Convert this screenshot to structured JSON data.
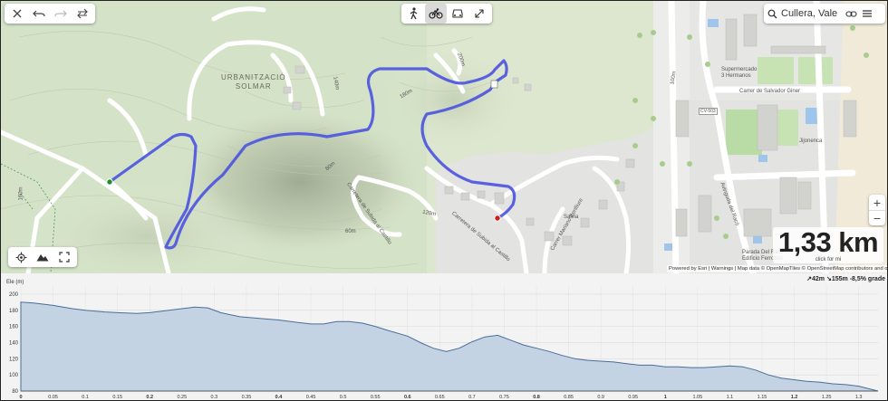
{
  "toolbar": {
    "close_icon": "close-icon",
    "undo_icon": "undo-icon",
    "redo_icon": "redo-icon",
    "reverse_icon": "reverse-route-icon"
  },
  "modes": [
    {
      "name": "walk",
      "icon": "walking-icon",
      "active": false
    },
    {
      "name": "bike",
      "icon": "bicycle-icon",
      "active": true
    },
    {
      "name": "car",
      "icon": "car-icon",
      "active": false
    },
    {
      "name": "straight",
      "icon": "straight-line-icon",
      "active": false
    }
  ],
  "search": {
    "value": "Cullera, Vale",
    "placeholder": ""
  },
  "map": {
    "labels": {
      "urbanitzacio": "URBANITZACIÓ",
      "solmar": "SOLMAR",
      "supermercado": "Supermercado",
      "hermanos": "3 Hermanos",
      "salvador_giner": "Carrer de Salvador Giner",
      "cv503": "CV-503",
      "jijonenca": "Jijonenca",
      "carretera": "Carretera de Subida al Castillo",
      "carretera2": "Carretera de Subida al Castillo",
      "salvia": "Salvia",
      "mariano": "Carrer Mariano Benlliure",
      "avinguda": "Avinguda del Racó",
      "parada": "Parada Del Racó",
      "edificio": "Edificio Ferrobós",
      "contours": [
        "160m",
        "140m",
        "120m",
        "100m",
        "80m",
        "60m",
        "200m",
        "180m"
      ]
    },
    "attribution": "Powered by Esri | Warnings | Map data © OpenMapTiles © OpenStreetMap contributors and others  Help",
    "route_color": "#4a52e0",
    "start_color": "#1f8c2e",
    "end_color": "#d21c1c"
  },
  "zoom": {
    "in": "+",
    "out": "−"
  },
  "bottom_controls": [
    "locate-icon",
    "terrain-icon",
    "fullscreen-icon"
  ],
  "distance": {
    "value": "1,33 km",
    "hint": "click for mi"
  },
  "stats": {
    "ascent": "↗42m",
    "descent": "↘155m",
    "grade": "-8,5% grade"
  },
  "chart_data": {
    "type": "area",
    "title": "",
    "ylabel": "Ele (m)",
    "xlabel": "",
    "ylim": [
      80,
      210
    ],
    "xlim": [
      0,
      1.33
    ],
    "yticks": [
      80,
      100,
      120,
      140,
      160,
      180,
      200
    ],
    "xticks": [
      "0",
      "0.05",
      "0.1",
      "0.15",
      "0.2",
      "0.25",
      "0.3",
      "0.35",
      "0.4",
      "0.45",
      "0.5",
      "0.55",
      "0.6",
      "0.65",
      "0.7",
      "0.75",
      "0.8",
      "0.85",
      "0.9",
      "0.95",
      "1",
      "1.05",
      "1.1",
      "1.15",
      "1.2",
      "1.25",
      "1.3"
    ],
    "x": [
      0,
      0.02,
      0.05,
      0.08,
      0.1,
      0.13,
      0.15,
      0.18,
      0.2,
      0.23,
      0.25,
      0.27,
      0.29,
      0.31,
      0.34,
      0.37,
      0.4,
      0.43,
      0.45,
      0.47,
      0.49,
      0.51,
      0.53,
      0.55,
      0.57,
      0.6,
      0.62,
      0.64,
      0.66,
      0.68,
      0.7,
      0.72,
      0.74,
      0.76,
      0.78,
      0.8,
      0.82,
      0.84,
      0.86,
      0.88,
      0.9,
      0.92,
      0.94,
      0.96,
      0.98,
      1.0,
      1.02,
      1.04,
      1.06,
      1.08,
      1.1,
      1.12,
      1.14,
      1.16,
      1.18,
      1.2,
      1.22,
      1.24,
      1.26,
      1.28,
      1.3,
      1.33
    ],
    "y": [
      190,
      189,
      186,
      182,
      180,
      178,
      177,
      176,
      177,
      180,
      182,
      184,
      183,
      177,
      172,
      170,
      168,
      165,
      163,
      163,
      166,
      166,
      164,
      160,
      155,
      148,
      140,
      133,
      129,
      133,
      141,
      147,
      149,
      143,
      137,
      133,
      129,
      124,
      120,
      118,
      117,
      116,
      114,
      112,
      112,
      110,
      110,
      109,
      109,
      110,
      111,
      110,
      106,
      100,
      96,
      94,
      92,
      91,
      89,
      88,
      86,
      80
    ],
    "fill": "#c4d3e4",
    "stroke": "#4a6d99",
    "grid": true
  }
}
